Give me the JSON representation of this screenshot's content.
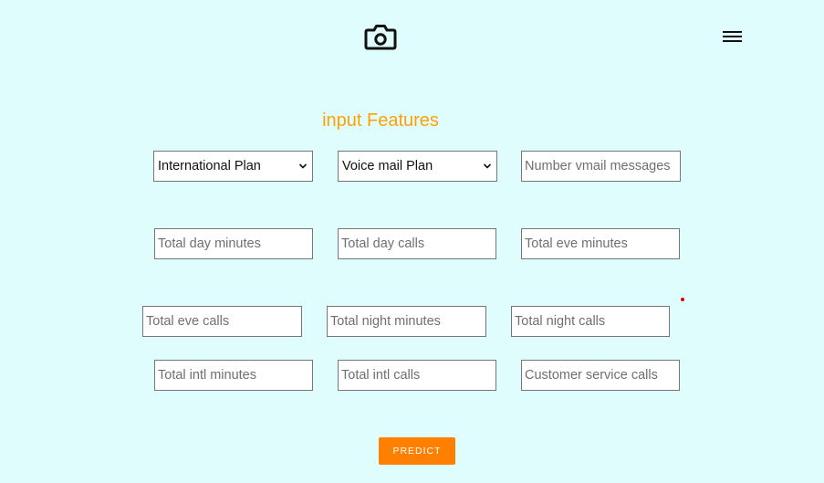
{
  "header": {
    "logo_icon": "camera-icon",
    "menu_icon": "hamburger-menu-icon"
  },
  "form": {
    "title": "input Features",
    "international_plan": {
      "selected": "International Plan"
    },
    "voice_mail_plan": {
      "selected": "Voice mail Plan"
    },
    "fields": {
      "number_vmail_messages": {
        "placeholder": "Number vmail messages",
        "value": ""
      },
      "total_day_minutes": {
        "placeholder": "Total day minutes",
        "value": ""
      },
      "total_day_calls": {
        "placeholder": "Total day calls",
        "value": ""
      },
      "total_eve_minutes": {
        "placeholder": "Total eve minutes",
        "value": ""
      },
      "total_eve_calls": {
        "placeholder": "Total eve calls",
        "value": ""
      },
      "total_night_minutes": {
        "placeholder": "Total night minutes",
        "value": ""
      },
      "total_night_calls": {
        "placeholder": "Total night calls",
        "value": ""
      },
      "total_intl_minutes": {
        "placeholder": "Total intl minutes",
        "value": ""
      },
      "total_intl_calls": {
        "placeholder": "Total intl calls",
        "value": ""
      },
      "customer_service_calls": {
        "placeholder": "Customer service calls",
        "value": ""
      }
    },
    "predict_label": "PREDICT"
  },
  "colors": {
    "background": "#e0fdfd",
    "title": "#ff9f00",
    "button": "#ff7f00",
    "dot": "#d40000"
  }
}
